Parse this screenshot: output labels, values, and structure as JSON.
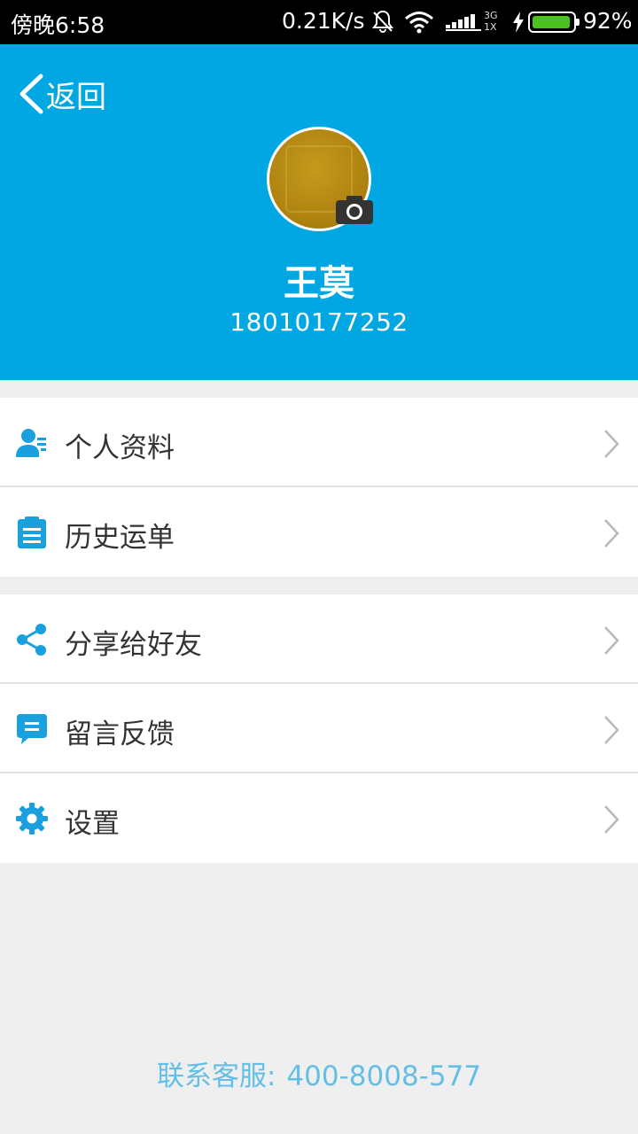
{
  "status_bar": {
    "time": "傍晚6:58",
    "speed": "0.21K/s",
    "network_top": "3G",
    "network_bottom": "1X",
    "battery": "92%"
  },
  "header": {
    "back_label": "返回",
    "user_name": "王莫",
    "phone": "18010177252"
  },
  "menu_group_1": [
    {
      "label": "个人资料",
      "icon": "user-profile-icon"
    },
    {
      "label": "历史运单",
      "icon": "document-list-icon"
    }
  ],
  "menu_group_2": [
    {
      "label": "分享给好友",
      "icon": "share-icon"
    },
    {
      "label": "留言反馈",
      "icon": "message-icon"
    },
    {
      "label": "设置",
      "icon": "gear-icon"
    }
  ],
  "footer": {
    "label": "联系客服:",
    "number": "400-8008-577"
  },
  "colors": {
    "header_bg": "#00a7e2",
    "icon_blue": "#1a9fdf",
    "footer_text": "#64bfe6",
    "page_bg": "#efefef"
  }
}
